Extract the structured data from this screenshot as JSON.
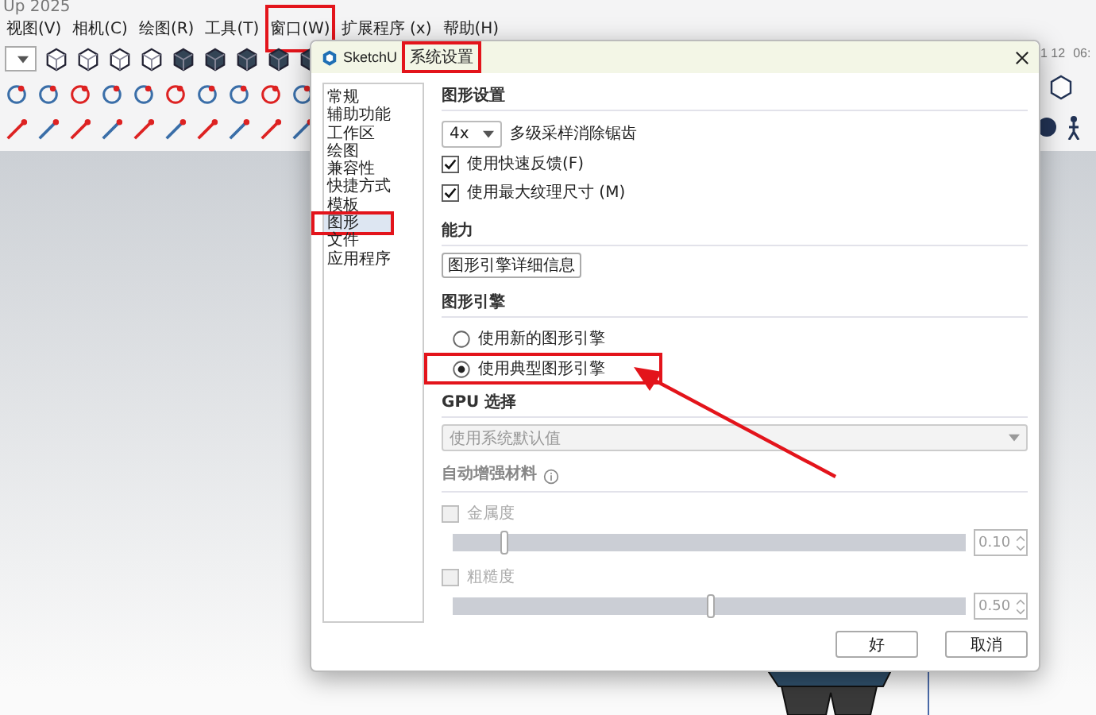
{
  "app": {
    "title": "Up 2025",
    "menu": [
      {
        "label": "视图(V)",
        "highlighted": false
      },
      {
        "label": "相机(C)",
        "highlighted": false
      },
      {
        "label": "绘图(R)",
        "highlighted": false
      },
      {
        "label": "工具(T)",
        "highlighted": false
      },
      {
        "label": "窗口(W)",
        "highlighted": true
      },
      {
        "label": "扩展程序 (x)",
        "highlighted": false
      },
      {
        "label": "帮助(H)",
        "highlighted": false
      }
    ],
    "readouts": [
      "1 12",
      "06:"
    ]
  },
  "dialog": {
    "app_name": "SketchU",
    "title": "系统设置",
    "title_highlighted": true,
    "sidebar": [
      {
        "label": "常规",
        "selected": false,
        "highlighted": false
      },
      {
        "label": "辅助功能",
        "selected": false,
        "highlighted": false
      },
      {
        "label": "工作区",
        "selected": false,
        "highlighted": false
      },
      {
        "label": "绘图",
        "selected": false,
        "highlighted": false
      },
      {
        "label": "兼容性",
        "selected": false,
        "highlighted": false
      },
      {
        "label": "快捷方式",
        "selected": false,
        "highlighted": false
      },
      {
        "label": "模板",
        "selected": false,
        "highlighted": false
      },
      {
        "label": "图形",
        "selected": true,
        "highlighted": true
      },
      {
        "label": "文件",
        "selected": false,
        "highlighted": false
      },
      {
        "label": "应用程序",
        "selected": false,
        "highlighted": false
      }
    ],
    "graphics_settings": {
      "heading": "图形设置",
      "antialias_value": "4x",
      "antialias_label": "多级采样消除锯齿",
      "checkboxes": [
        {
          "label": "使用快速反馈(F)",
          "checked": true
        },
        {
          "label": "使用最大纹理尺寸 (M)",
          "checked": true
        }
      ]
    },
    "capabilities": {
      "heading": "能力",
      "button": "图形引擎详细信息"
    },
    "engine": {
      "heading": "图形引擎",
      "options": [
        {
          "label": "使用新的图形引擎",
          "selected": false,
          "highlighted": false
        },
        {
          "label": "使用典型图形引擎",
          "selected": true,
          "highlighted": true
        }
      ]
    },
    "gpu": {
      "heading": "GPU 选择",
      "value": "使用系统默认值",
      "disabled": true
    },
    "materials": {
      "heading": "自动增强材料",
      "rows": [
        {
          "label": "金属度",
          "checked": false,
          "disabled": true,
          "level": 0.1,
          "value": "0.10"
        },
        {
          "label": "粗糙度",
          "checked": false,
          "disabled": true,
          "level": 0.5,
          "value": "0.50"
        }
      ]
    },
    "buttons": [
      "好",
      "取消"
    ]
  }
}
